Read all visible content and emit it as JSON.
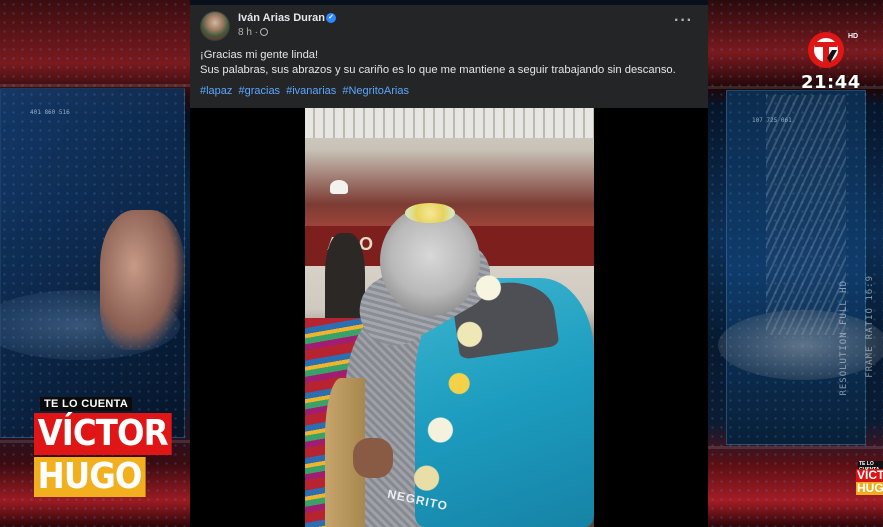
{
  "broadcast": {
    "channel_hd": "HD",
    "clock": "21:44",
    "show": {
      "kicker": "TE LO CUENTA",
      "name_line1": "VÍCTOR",
      "name_line2": "HUGO"
    },
    "aspect_text": "FRAME RATIO 16:9",
    "resolution_text": "RESOLUTION FULL HD",
    "readout_left": "401 860 516",
    "readout_right": "107 725 061",
    "colors": {
      "red": "#e01616",
      "yellow": "#f2b01e"
    }
  },
  "post": {
    "author": "Iván Arias Duran",
    "verified": true,
    "time": "8 h ·",
    "more_icon": "more-horizontal-icon",
    "text_lines": [
      "¡Gracias mi gente linda!",
      "Sus palabras, sus abrazos y su cariño es lo que me mantiene a seguir trabajando sin descanso."
    ],
    "hashtags": [
      "#lapaz",
      "#gracias",
      "#ivanarias",
      "#NegritoArias"
    ],
    "video": {
      "banner_text": "ACO   PAC",
      "jacket_text": "NEGRITO"
    },
    "colors": {
      "card": "#242526",
      "link": "#5aa7ff",
      "verified": "#2d88ff"
    }
  }
}
